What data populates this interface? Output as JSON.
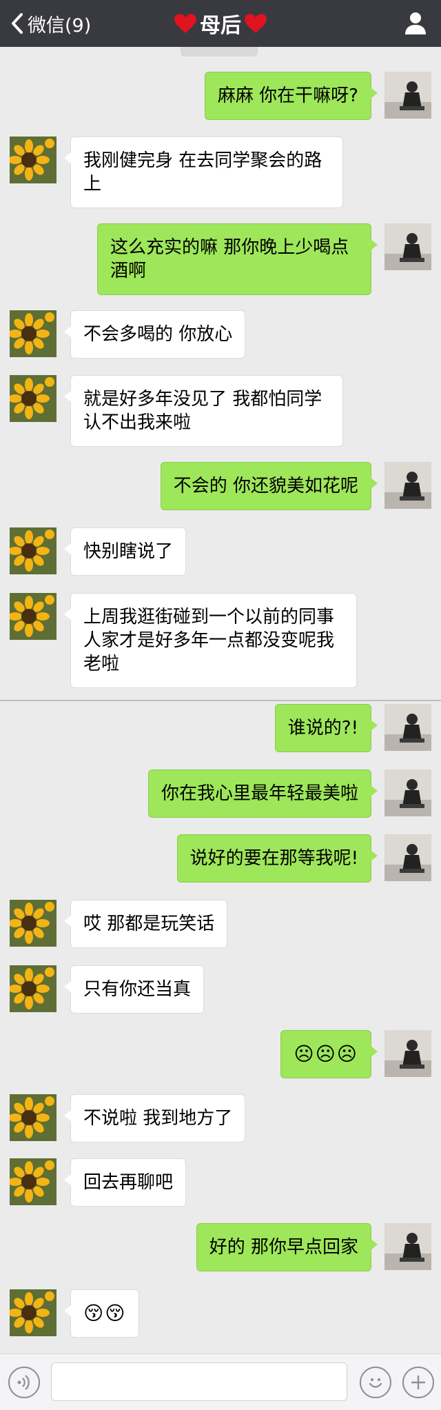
{
  "header": {
    "back_label": "微信(9)",
    "title": "母后"
  },
  "colors": {
    "topbar": "#393a3f",
    "sent_bubble": "#9ee65a",
    "received_bubble": "#ffffff",
    "chat_background": "#ebebeb",
    "heart": "#e0131e"
  },
  "icons": {
    "back": "chevron-left-icon",
    "heart": "heart-icon",
    "profile": "person-icon",
    "voice": "voice-icon",
    "emoji": "smiley-icon",
    "more": "plus-icon"
  },
  "messages": [
    {
      "side": "right",
      "text": "麻麻 你在干嘛呀?"
    },
    {
      "side": "left",
      "text": "我刚健完身 在去同学聚会的路上"
    },
    {
      "side": "right",
      "text": "这么充实的嘛 那你晚上少喝点酒啊"
    },
    {
      "side": "left",
      "text": "不会多喝的 你放心"
    },
    {
      "side": "left",
      "text": "就是好多年没见了 我都怕同学认不出我来啦"
    },
    {
      "side": "right",
      "text": "不会的 你还貌美如花呢"
    },
    {
      "side": "left",
      "text": "快别瞎说了"
    },
    {
      "side": "left",
      "text": "上周我逛街碰到一个以前的同事人家才是好多年一点都没变呢我老啦"
    },
    {
      "side": "right",
      "text": "谁说的?!"
    },
    {
      "side": "right",
      "text": "你在我心里最年轻最美啦"
    },
    {
      "side": "right",
      "text": "说好的要在那等我呢!"
    },
    {
      "side": "left",
      "text": "哎 那都是玩笑话"
    },
    {
      "side": "left",
      "text": "只有你还当真"
    },
    {
      "side": "right",
      "text": "☹☹☹"
    },
    {
      "side": "left",
      "text": "不说啦 我到地方了"
    },
    {
      "side": "left",
      "text": "回去再聊吧"
    },
    {
      "side": "right",
      "text": "好的 那你早点回家"
    },
    {
      "side": "left",
      "text": "😚😚"
    }
  ],
  "input": {
    "value": "",
    "placeholder": ""
  }
}
